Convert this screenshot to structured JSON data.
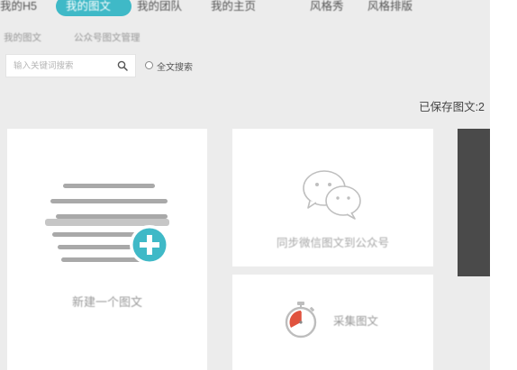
{
  "nav": {
    "items": [
      {
        "label": "我的H5"
      },
      {
        "label": "我的图文"
      },
      {
        "label": "我的团队"
      },
      {
        "label": "我的主页"
      },
      {
        "label": "风格秀"
      },
      {
        "label": "风格排版"
      }
    ]
  },
  "subtabs": {
    "items": [
      {
        "label": "我的图文"
      },
      {
        "label": "公众号图文管理"
      }
    ]
  },
  "search": {
    "placeholder": "输入关键词搜索",
    "fulltext_label": "全文搜索"
  },
  "saved": {
    "label": "已保存图文:",
    "count": "2"
  },
  "cards": {
    "new_label": "新建一个图文",
    "sync_label": "同步微信图文到公众号",
    "collect_label": "采集图文"
  },
  "colors": {
    "accent": "#3fb9c7",
    "background": "#ececec",
    "collect_red": "#e0533e"
  }
}
